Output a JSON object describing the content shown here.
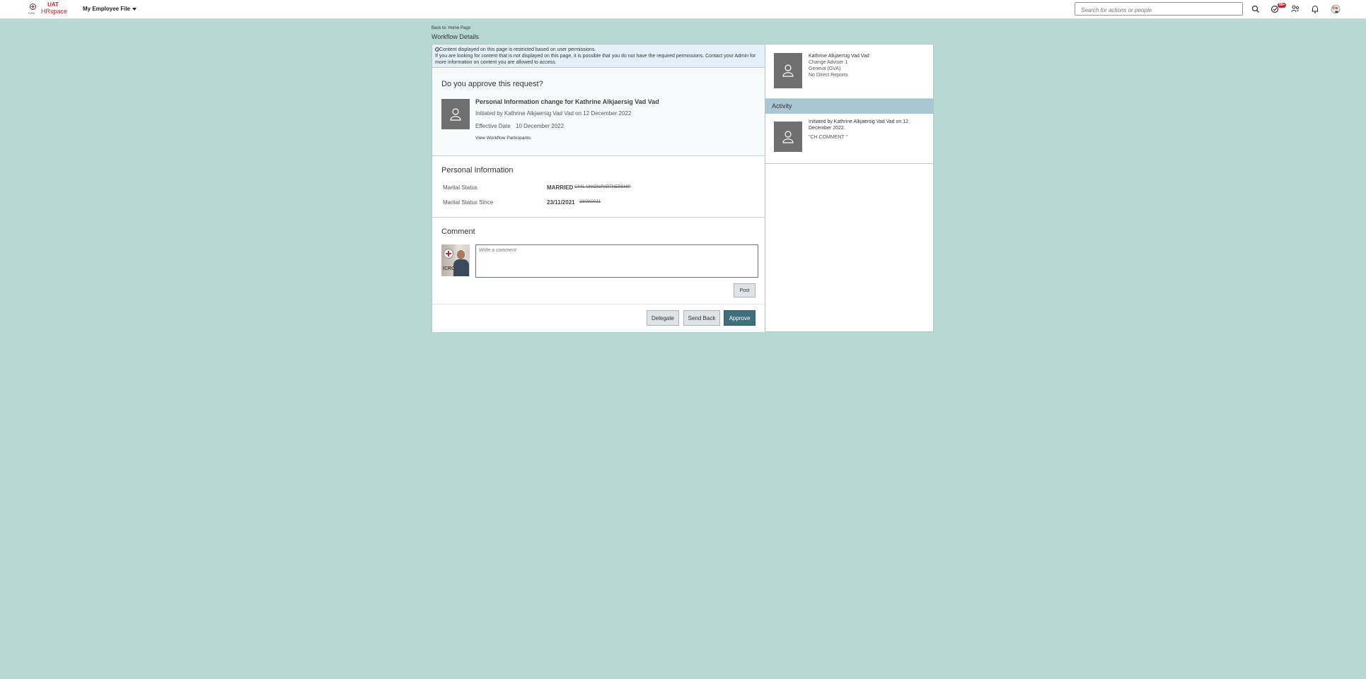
{
  "header": {
    "logo_seal_text": "ICRC",
    "logo_uat": "UAT",
    "logo_brand": "HRspace",
    "module_label": "My Employee File",
    "search_placeholder": "Search for actions or people",
    "todo_badge": "99+"
  },
  "breadcrumb": {
    "back_label": "Back to: Home Page",
    "page_title": "Workflow Details"
  },
  "banner": {
    "line1": "Content displayed on this page is restricted based on user permissions.",
    "line2": "If you are looking for content that is not displayed on this page, it is possible that you do not have the required permissions. Contact your Admin for more information on content you are allowed to access."
  },
  "request": {
    "question": "Do you approve this request?",
    "title": "Personal Information change for Kathrine Alkjaersig Vad Vad",
    "initiated": "Initiated by Kathrine Alkjaersig Vad Vad on 12 December 2022",
    "effective_label": "Effective Date",
    "effective_value": "10 December 2022",
    "view_participants": "View Workflow Participants"
  },
  "personal_info": {
    "title": "Personal Information",
    "fields": [
      {
        "label": "Marital Status",
        "new_value": "MARRIED",
        "old_value": "CIVIL UNION/PARTNERSHIP"
      },
      {
        "label": "Marital Status Since",
        "new_value": "23/11/2021",
        "old_value": "23/09/2021"
      }
    ]
  },
  "comment": {
    "title": "Comment",
    "placeholder": "Write a comment",
    "photo_label": "ICRC",
    "post_label": "Post"
  },
  "actions": {
    "delegate": "Delegate",
    "send_back": "Send Back",
    "approve": "Approve"
  },
  "subject": {
    "name": "Kathrine Alkjaersig Vad Vad",
    "role": "Change Adviser 1",
    "location": "Geneva (GVA)",
    "reports": "No Direct Reports"
  },
  "activity": {
    "header": "Activity",
    "items": [
      {
        "text": "Initiated by Kathrine Alkjaersig Vad Vad on 12 December 2022.",
        "comment": "\"CH COMMENT \""
      }
    ]
  },
  "colors": {
    "page_bg": "#b8d9d3",
    "approve_button": "#3d6f7c",
    "activity_header": "#a9c7d0",
    "brand_red": "#c0262d"
  }
}
